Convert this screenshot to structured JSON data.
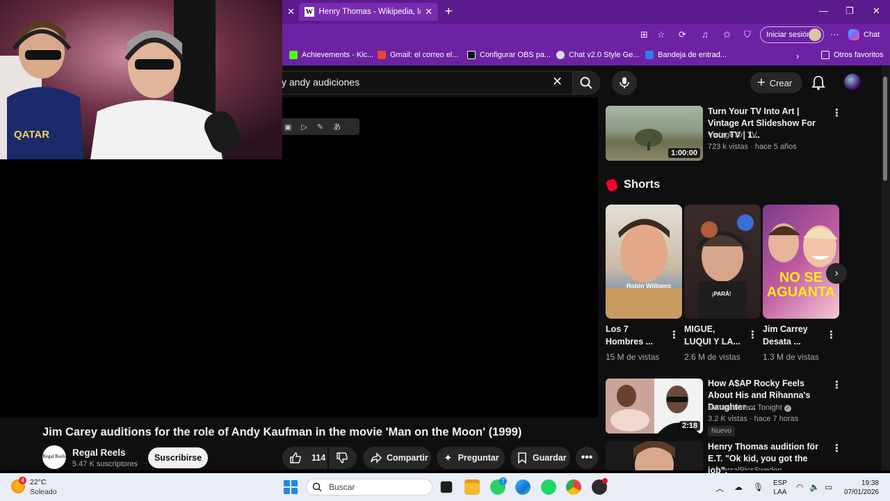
{
  "browser": {
    "active_tab_title": "Henry Thomas - Wikipedia, la encic",
    "signin_label": "Iniciar sesión",
    "chat_label": "Chat",
    "bookmarks": [
      {
        "label": "Achievements - Kic...",
        "color": "#53fc18"
      },
      {
        "label": "Gmail: el correo el...",
        "color": "#ea4335"
      },
      {
        "label": "Configurar OBS pa...",
        "color": "#111111"
      },
      {
        "label": "Chat v2.0 Style Ge...",
        "color": "#dddddd"
      },
      {
        "label": "Bandeja de entrad...",
        "color": "#2f7be8"
      }
    ],
    "other_favorites": "Otros favoritos"
  },
  "youtube": {
    "search_value": "y andy audiciones",
    "create_label": "Crear",
    "video_title": "Jim Carey auditions for the role of Andy Kaufman in the movie 'Man on the Moon' (1999)",
    "channel": {
      "name": "Regal Reels",
      "subs": "5.47 K suscriptores",
      "avatar_text": "Regal Reels"
    },
    "subscribe_label": "Suscribirse",
    "likes": "114",
    "share_label": "Compartir",
    "ask_label": "Preguntar",
    "save_label": "Guardar",
    "sidebar": {
      "video1": {
        "title": "Turn Your TV Into Art | Vintage Art Slideshow For Your TV | 1...",
        "channel": "Vintage Art TV",
        "meta": "723 k vistas · hace 5 años",
        "duration": "1:00:00"
      },
      "shorts_heading": "Shorts",
      "shorts": [
        {
          "title": "Los 7 Hombres ...",
          "views": "15 M de vistas",
          "overlay": "Robin Williams"
        },
        {
          "title": "MIGUE, LUQUI Y LA...",
          "views": "2.6 M de vistas",
          "overlay": "¡PARÁ!"
        },
        {
          "title": "Jim Carrey Desata ...",
          "views": "1.3 M de vistas",
          "overlay": "NO SE AGUANTA"
        }
      ],
      "video2": {
        "title": "How A$AP Rocky Feels About His and Rihanna's Daughter ...",
        "channel": "Entertainment Tonight",
        "meta": "3.2 K vistas · hace 7 horas",
        "duration": "2:18",
        "badge": "Nuevo"
      },
      "video3": {
        "title": "Henry Thomas audition för E.T. \"Ok kid, you got the job\".",
        "channel": "UniversalPicsSweden"
      }
    }
  },
  "taskbar": {
    "temp": "22°C",
    "weather": "Soleado",
    "weather_badge": "4",
    "search_placeholder": "Buscar",
    "lang_line1": "ESP",
    "lang_line2": "LAA",
    "time": "19:38",
    "date": "07/01/2026",
    "whatsapp_badge": "7"
  }
}
